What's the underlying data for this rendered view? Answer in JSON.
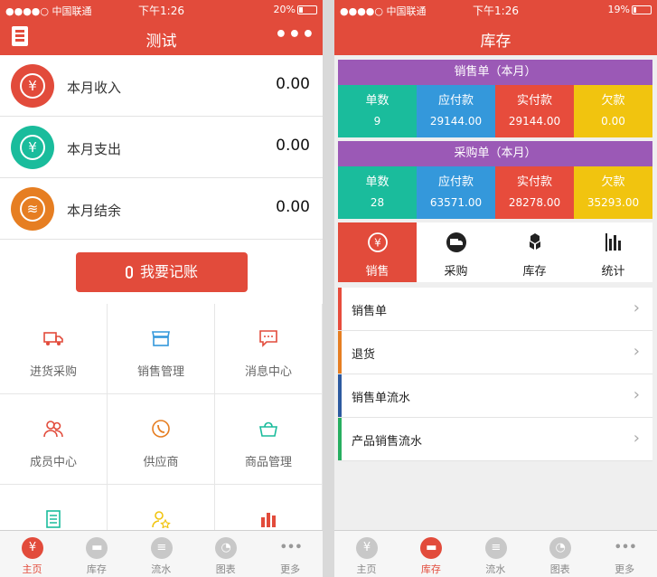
{
  "colors": {
    "brand": "#e24b3b",
    "purple": "#9b59b6",
    "teal": "#1abc9c",
    "blue": "#3498db",
    "red": "#e74c3c",
    "yellow": "#f1c40f",
    "orange": "#e67e22"
  },
  "left": {
    "status": {
      "carrier": "●●●●○ 中国联通",
      "time": "下午1:26",
      "battery": "20%",
      "battery_level": 0.2
    },
    "title": "测试",
    "summary": [
      {
        "label": "本月收入",
        "value": "0.00",
        "icon": "yen-icon"
      },
      {
        "label": "本月支出",
        "value": "0.00",
        "icon": "yen-icon"
      },
      {
        "label": "本月结余",
        "value": "0.00",
        "icon": "coins-icon"
      }
    ],
    "cta_label": "我要记账",
    "grid": [
      {
        "label": "进货采购",
        "icon": "truck-icon"
      },
      {
        "label": "销售管理",
        "icon": "store-icon"
      },
      {
        "label": "消息中心",
        "icon": "message-icon"
      },
      {
        "label": "成员中心",
        "icon": "members-icon"
      },
      {
        "label": "供应商",
        "icon": "phone-icon"
      },
      {
        "label": "商品管理",
        "icon": "basket-icon"
      },
      {
        "label": "",
        "icon": "document-icon"
      },
      {
        "label": "",
        "icon": "star-person-icon"
      },
      {
        "label": "",
        "icon": "bar-chart-icon"
      }
    ],
    "tabs": [
      {
        "label": "主页",
        "icon": "yen-bag-icon",
        "active": true
      },
      {
        "label": "库存",
        "icon": "truck-icon",
        "active": false
      },
      {
        "label": "流水",
        "icon": "list-icon",
        "active": false
      },
      {
        "label": "图表",
        "icon": "pie-icon",
        "active": false
      },
      {
        "label": "更多",
        "icon": "more-icon",
        "active": false
      }
    ]
  },
  "right": {
    "status": {
      "carrier": "●●●●○ 中国联通",
      "time": "下午1:26",
      "battery": "19%",
      "battery_level": 0.19
    },
    "title": "库存",
    "sales": {
      "header": "销售单（本月）",
      "cols": [
        {
          "h": "单数",
          "v": "9"
        },
        {
          "h": "应付款",
          "v": "29144.00"
        },
        {
          "h": "实付款",
          "v": "29144.00"
        },
        {
          "h": "欠款",
          "v": "0.00"
        }
      ]
    },
    "purchase": {
      "header": "采购单（本月）",
      "cols": [
        {
          "h": "单数",
          "v": "28"
        },
        {
          "h": "应付款",
          "v": "63571.00"
        },
        {
          "h": "实付款",
          "v": "28278.00"
        },
        {
          "h": "欠款",
          "v": "35293.00"
        }
      ]
    },
    "categories": [
      {
        "label": "销售",
        "icon": "yen-circle-icon",
        "active": true
      },
      {
        "label": "采购",
        "icon": "truck-icon",
        "active": false
      },
      {
        "label": "库存",
        "icon": "boxes-icon",
        "active": false
      },
      {
        "label": "统计",
        "icon": "bar-chart-icon",
        "active": false
      }
    ],
    "list": [
      {
        "label": "销售单",
        "color": "#e74c3c"
      },
      {
        "label": "退货",
        "color": "#e67e22"
      },
      {
        "label": "销售单流水",
        "color": "#2c5aa0"
      },
      {
        "label": "产品销售流水",
        "color": "#27ae60"
      }
    ],
    "tabs": [
      {
        "label": "主页",
        "icon": "yen-bag-icon",
        "active": false
      },
      {
        "label": "库存",
        "icon": "truck-icon",
        "active": true
      },
      {
        "label": "流水",
        "icon": "list-icon",
        "active": false
      },
      {
        "label": "图表",
        "icon": "pie-icon",
        "active": false
      },
      {
        "label": "更多",
        "icon": "more-icon",
        "active": false
      }
    ]
  }
}
